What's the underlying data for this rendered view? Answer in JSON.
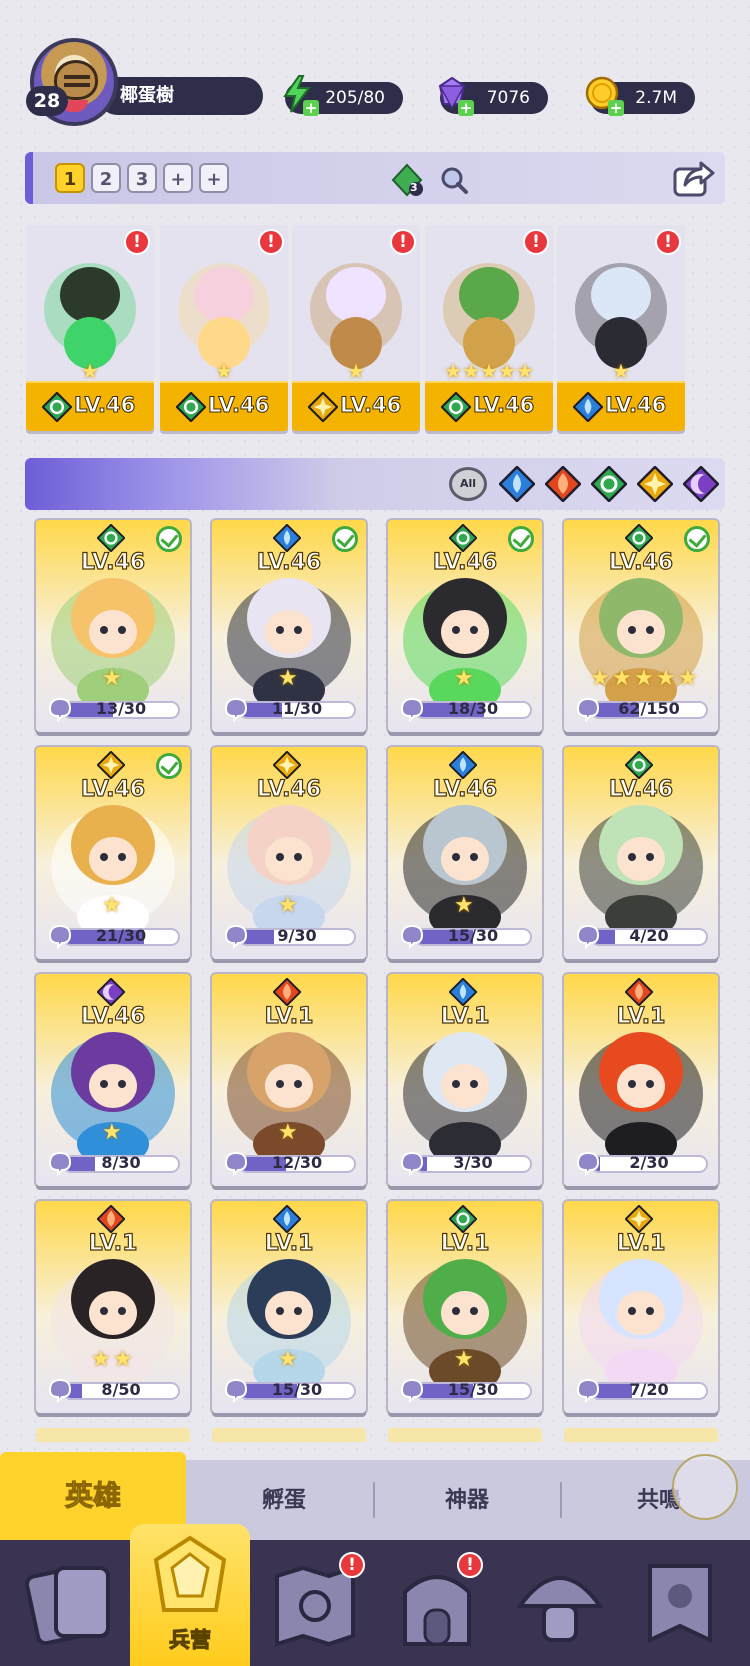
{
  "player": {
    "level": "28",
    "name": "椰蛋樹"
  },
  "resources": [
    {
      "icon": "lightning-icon",
      "value": "205/80"
    },
    {
      "icon": "gem-icon",
      "value": "7076"
    },
    {
      "icon": "coin-icon",
      "value": "2.7M"
    }
  ],
  "team_bar": {
    "slots": [
      "1",
      "2",
      "3",
      "+",
      "+"
    ],
    "active_slot": "1",
    "gem_count": "3"
  },
  "team": [
    {
      "element": "nature",
      "level": "LV.46",
      "stars": "★",
      "alert": "!"
    },
    {
      "element": "nature",
      "level": "LV.46",
      "stars": "★",
      "alert": "!"
    },
    {
      "element": "light",
      "level": "LV.46",
      "stars": "★",
      "alert": "!"
    },
    {
      "element": "nature",
      "level": "LV.46",
      "stars": "★★★★★",
      "alert": "!"
    },
    {
      "element": "water",
      "level": "LV.46",
      "stars": "★",
      "alert": "!"
    }
  ],
  "filters": {
    "all_label": "All",
    "elements": [
      "water",
      "fire",
      "nature",
      "light",
      "dark"
    ]
  },
  "heroes": [
    {
      "element": "nature",
      "level": "LV.46",
      "owned": true,
      "progress": "13/30",
      "ratio": 0.43,
      "stars": 1,
      "art": [
        "#f6c36b",
        "#9fcf7a"
      ]
    },
    {
      "element": "water",
      "level": "LV.46",
      "owned": true,
      "progress": "11/30",
      "ratio": 0.37,
      "stars": 1,
      "art": [
        "#e8e4f2",
        "#2e3242"
      ]
    },
    {
      "element": "nature",
      "level": "LV.46",
      "owned": true,
      "progress": "18/30",
      "ratio": 0.6,
      "stars": 1,
      "art": [
        "#2b2b2f",
        "#5ad85e"
      ]
    },
    {
      "element": "nature",
      "level": "LV.46",
      "owned": true,
      "progress": "62/150",
      "ratio": 0.41,
      "stars": 5,
      "art": [
        "#8fb86a",
        "#d4a04a"
      ]
    },
    {
      "element": "light",
      "level": "LV.46",
      "owned": true,
      "progress": "21/30",
      "ratio": 0.7,
      "stars": 1,
      "art": [
        "#e9b14d",
        "#ffffff"
      ]
    },
    {
      "element": "light",
      "level": "LV.46",
      "owned": false,
      "progress": "9/30",
      "ratio": 0.3,
      "stars": 1,
      "art": [
        "#f4d3c6",
        "#c6d7ee"
      ]
    },
    {
      "element": "water",
      "level": "LV.46",
      "owned": false,
      "progress": "15/30",
      "ratio": 0.5,
      "stars": 1,
      "art": [
        "#b9c5cf",
        "#2a2a2e"
      ]
    },
    {
      "element": "nature",
      "level": "LV.46",
      "owned": false,
      "progress": "4/20",
      "ratio": 0.2,
      "stars": 0,
      "art": [
        "#bfe3b6",
        "#3b3f3a"
      ]
    },
    {
      "element": "dark",
      "level": "LV.46",
      "owned": false,
      "progress": "8/30",
      "ratio": 0.27,
      "stars": 1,
      "art": [
        "#6b3ba0",
        "#2f8fd8"
      ]
    },
    {
      "element": "fire",
      "level": "LV.1",
      "owned": false,
      "progress": "12/30",
      "ratio": 0.4,
      "stars": 1,
      "art": [
        "#d7a36a",
        "#7a4a2a"
      ]
    },
    {
      "element": "water",
      "level": "LV.1",
      "owned": false,
      "progress": "3/30",
      "ratio": 0.1,
      "stars": 0,
      "art": [
        "#dfe8f2",
        "#2c2c34"
      ]
    },
    {
      "element": "fire",
      "level": "LV.1",
      "owned": false,
      "progress": "2/30",
      "ratio": 0.07,
      "stars": 0,
      "art": [
        "#e84a1f",
        "#1e1e22"
      ]
    },
    {
      "element": "fire",
      "level": "LV.1",
      "owned": false,
      "progress": "8/50",
      "ratio": 0.16,
      "stars": 2,
      "art": [
        "#2a2326",
        "#f2e6e6"
      ]
    },
    {
      "element": "water",
      "level": "LV.1",
      "owned": false,
      "progress": "15/30",
      "ratio": 0.5,
      "stars": 1,
      "art": [
        "#2c3d5a",
        "#b6d7ea"
      ]
    },
    {
      "element": "nature",
      "level": "LV.1",
      "owned": false,
      "progress": "15/30",
      "ratio": 0.5,
      "stars": 1,
      "art": [
        "#4fae4a",
        "#6b4a2a"
      ]
    },
    {
      "element": "light",
      "level": "LV.1",
      "owned": false,
      "progress": "7/20",
      "ratio": 0.35,
      "stars": 0,
      "art": [
        "#d6e4ff",
        "#f3d9f3"
      ]
    }
  ],
  "subtabs": [
    "英雄",
    "孵蛋",
    "神器",
    "共鳴"
  ],
  "nav": [
    {
      "icon": "cards-icon",
      "label": ""
    },
    {
      "icon": "barracks-icon",
      "label": "兵营",
      "active": true
    },
    {
      "icon": "map-icon",
      "label": "",
      "alert": "!"
    },
    {
      "icon": "castle-icon",
      "label": "",
      "alert": "!"
    },
    {
      "icon": "mushroom-icon",
      "label": ""
    },
    {
      "icon": "banner-icon",
      "label": ""
    }
  ],
  "colors": {
    "nature": "#2fa84f",
    "water": "#2a7fd8",
    "fire": "#e2461e",
    "light": "#e8a90e",
    "dark": "#7a3fc2",
    "accent_yellow": "#ffd22c",
    "panel_purple": "#6d5ed8",
    "nav_dark": "#3a3452"
  }
}
